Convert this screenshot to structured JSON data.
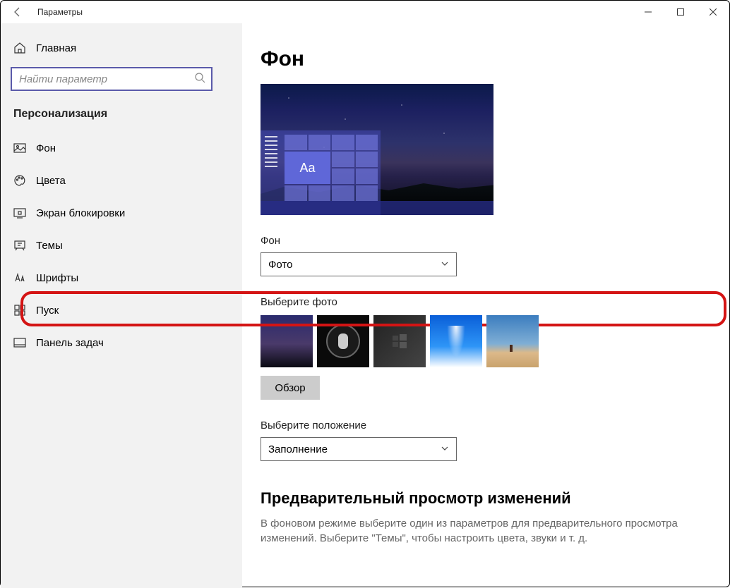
{
  "window": {
    "title": "Параметры"
  },
  "sidebar": {
    "home": "Главная",
    "search_placeholder": "Найти параметр",
    "section": "Персонализация",
    "items": [
      {
        "label": "Фон"
      },
      {
        "label": "Цвета"
      },
      {
        "label": "Экран блокировки"
      },
      {
        "label": "Темы"
      },
      {
        "label": "Шрифты"
      },
      {
        "label": "Пуск"
      },
      {
        "label": "Панель задач"
      }
    ]
  },
  "main": {
    "title": "Фон",
    "preview_tile_text": "Aa",
    "bg_label": "Фон",
    "bg_value": "Фото",
    "choose_photo_label": "Выберите фото",
    "browse_button": "Обзор",
    "fit_label": "Выберите положение",
    "fit_value": "Заполнение",
    "preview_heading": "Предварительный просмотр изменений",
    "preview_desc": "В фоновом режиме выберите один из параметров для предварительного просмотра изменений. Выберите \"Темы\", чтобы настроить цвета, звуки и т. д."
  }
}
